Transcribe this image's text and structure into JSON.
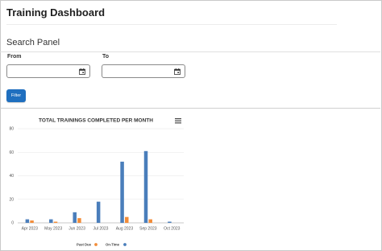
{
  "app": {
    "title": "Training Dashboard"
  },
  "search_panel": {
    "title": "Search Panel",
    "from_label": "From",
    "to_label": "To",
    "from_value": "",
    "to_value": "",
    "filter_label": "Filter"
  },
  "colors": {
    "accent": "#1f6fbf",
    "past_due": "#f28c38",
    "on_time": "#4a7ebb"
  },
  "icons": {
    "date_picker": "calendar-icon",
    "chart_menu": "hamburger-menu-icon"
  },
  "chart_data": {
    "type": "bar",
    "title": "TOTAL TRAININGS COMPLETED PER MONTH",
    "xlabel": "",
    "ylabel": "",
    "categories": [
      "Apr 2023",
      "May 2023",
      "Jun 2023",
      "Jul 2023",
      "Aug 2023",
      "Sep 2023",
      "Oct 2023"
    ],
    "ylim": [
      0,
      80
    ],
    "yticks": [
      0,
      20,
      40,
      60,
      80
    ],
    "grid": true,
    "legend_position": "bottom",
    "series": [
      {
        "name": "On-Time",
        "values": [
          3,
          3,
          9,
          18,
          52,
          61,
          1
        ]
      },
      {
        "name": "Past Due",
        "values": [
          2,
          1,
          4,
          0,
          5,
          3,
          0
        ]
      }
    ]
  }
}
